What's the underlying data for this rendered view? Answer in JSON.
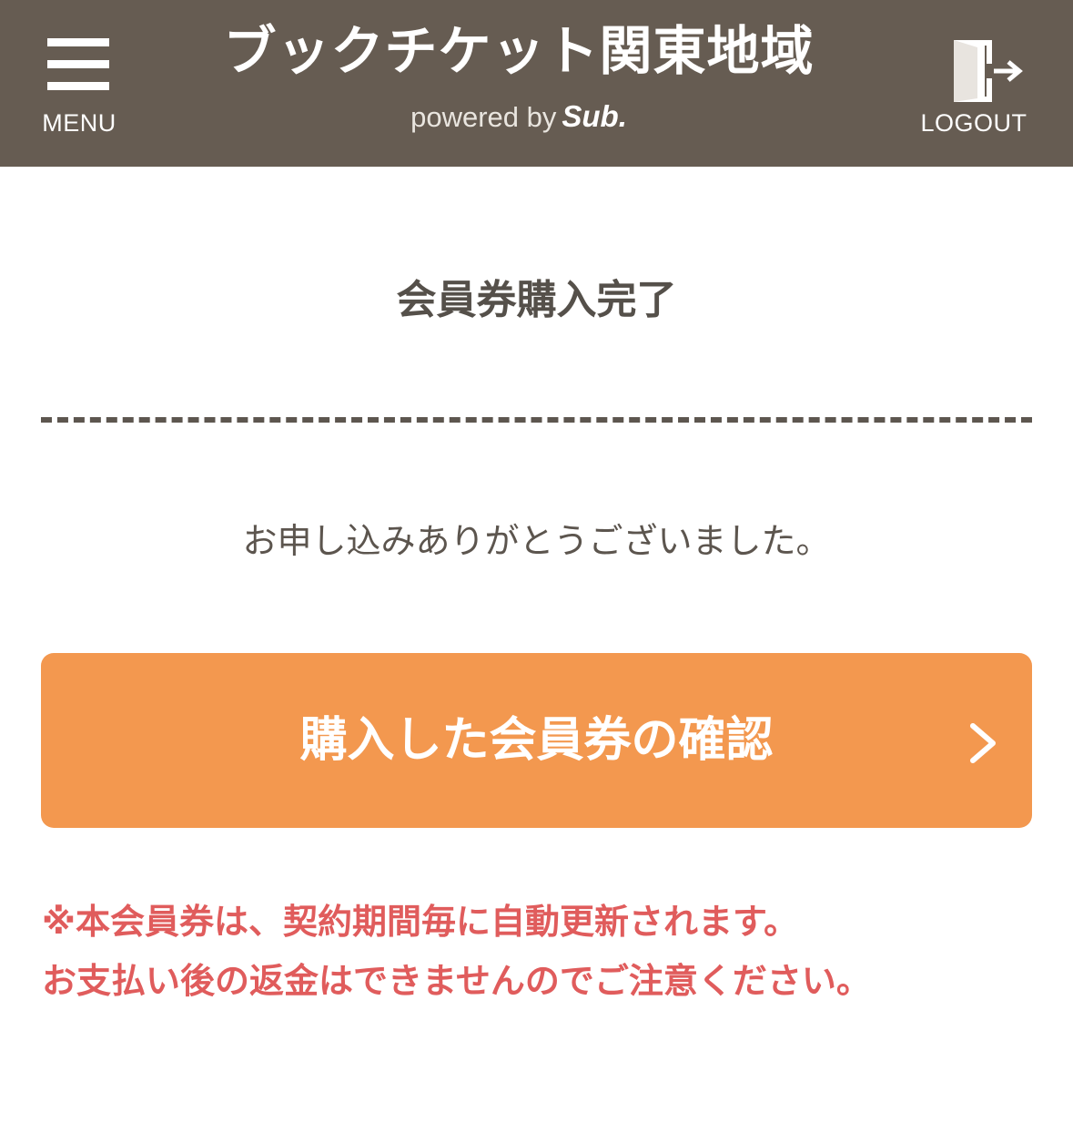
{
  "header": {
    "menu_label": "MENU",
    "title": "ブックチケット関東地域",
    "powered_by": "powered by",
    "powered_logo": "Sub.",
    "logout_label": "LOGOUT",
    "background_color": "#665c52"
  },
  "main": {
    "page_title": "会員券購入完了",
    "thanks_message": "お申し込みありがとうございました。",
    "confirm_button": {
      "label": "購入した会員券の確認",
      "icon": "chevron-right-icon",
      "color": "#f3984f"
    },
    "notice": {
      "line1": "※本会員券は、契約期間毎に自動更新されます。",
      "line2": "お支払い後の返金はできませんのでご注意ください。",
      "color": "#e05c5c"
    }
  }
}
